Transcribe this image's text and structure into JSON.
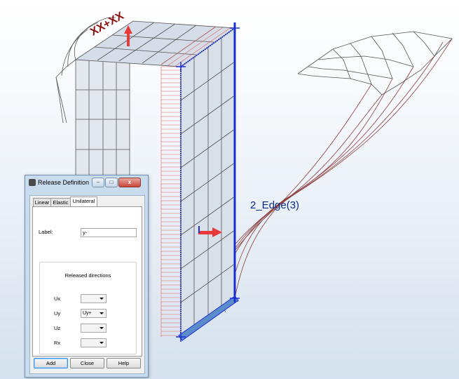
{
  "viewport": {
    "edge_label": "2_Edge(3)",
    "release_symbol": "XX+XX",
    "colors": {
      "mesh_line": "#555555",
      "panel_fill": "#d8e0ea",
      "selected_edge": "#1b2ed6",
      "release_hatch": "#e46060",
      "deformed_line": "#8b3a3a",
      "arrow": "#e83a3a"
    }
  },
  "dialog": {
    "title": "Release Definition",
    "window_buttons": [
      "–",
      "□",
      "x"
    ],
    "tabs": [
      "Linear",
      "Elastic",
      "Unilateral"
    ],
    "active_tab": "Unilateral",
    "label_caption": "Label:",
    "label_value": "y-",
    "group_title": "Released directions",
    "directions": [
      {
        "name": "Ux",
        "value": ""
      },
      {
        "name": "Uy",
        "value": "Uy+"
      },
      {
        "name": "Uz",
        "value": ""
      },
      {
        "name": "Rx",
        "value": ""
      }
    ],
    "buttons": {
      "add": "Add",
      "close": "Close",
      "help": "Help"
    }
  }
}
